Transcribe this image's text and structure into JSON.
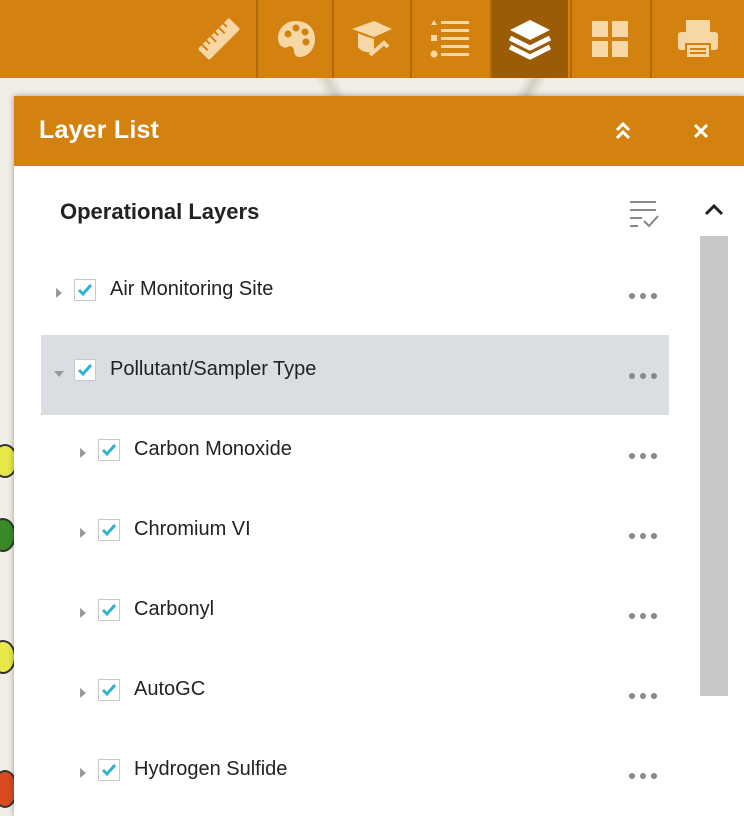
{
  "toolbar": {
    "tools": [
      {
        "name": "measurement",
        "icon": "ruler-icon"
      },
      {
        "name": "basemap-gallery",
        "icon": "palette-icon"
      },
      {
        "name": "about",
        "icon": "graduation-cap-icon"
      },
      {
        "name": "legend",
        "icon": "list-icon"
      },
      {
        "name": "layer-list",
        "icon": "layers-icon",
        "active": true
      },
      {
        "name": "more-widgets",
        "icon": "grid-icon"
      },
      {
        "name": "print",
        "icon": "printer-icon"
      }
    ],
    "color": "#d3820f",
    "active_color": "#9c5b06"
  },
  "panel": {
    "title": "Layer List",
    "collapse_icon": "double-chevron-up-icon",
    "close_icon": "close-icon",
    "section_title": "Operational Layers",
    "filter_icon": "filter-list-icon",
    "layers": [
      {
        "label": "Air Monitoring Site",
        "checked": true,
        "expanded": false,
        "level": 0
      },
      {
        "label": "Pollutant/Sampler Type",
        "checked": true,
        "expanded": true,
        "level": 0,
        "selected": true
      },
      {
        "label": "Carbon Monoxide",
        "checked": true,
        "expanded": false,
        "level": 1
      },
      {
        "label": "Chromium VI",
        "checked": true,
        "expanded": false,
        "level": 1
      },
      {
        "label": "Carbonyl",
        "checked": true,
        "expanded": false,
        "level": 1
      },
      {
        "label": "AutoGC",
        "checked": true,
        "expanded": false,
        "level": 1
      },
      {
        "label": "Hydrogen Sulfide",
        "checked": true,
        "expanded": false,
        "level": 1
      }
    ]
  },
  "colors": {
    "check": "#2fb1d8",
    "header": "#d3820f",
    "selected_row": "#dadde2"
  }
}
